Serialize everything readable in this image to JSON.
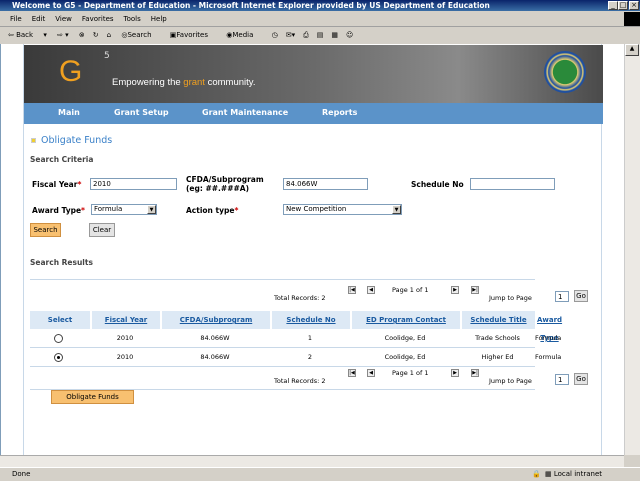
{
  "window": {
    "title": "Welcome to G5 - Department of Education - Microsoft Internet Explorer provided by US Department of Education"
  },
  "menu": [
    "File",
    "Edit",
    "View",
    "Favorites",
    "Tools",
    "Help"
  ],
  "toolbar": {
    "back": "Back",
    "search": "Search",
    "favorites": "Favorites",
    "media": "Media"
  },
  "banner": {
    "logo": "G",
    "logo_sup": "5",
    "tagline_pre": "Empowering the ",
    "tagline_accent": "grant",
    "tagline_post": " community."
  },
  "nav": [
    "Main",
    "Grant Setup",
    "Grant Maintenance",
    "Reports"
  ],
  "page": {
    "title": "Obligate Funds",
    "criteria_heading": "Search Criteria",
    "results_heading": "Search Results"
  },
  "form": {
    "fiscal_year_label": "Fiscal Year",
    "fiscal_year_value": "2010",
    "cfda_label": "CFDA/Subprogram",
    "cfda_hint": "(eg: ##.###A)",
    "cfda_value": "84.066W",
    "schedule_label": "Schedule No",
    "schedule_value": "",
    "award_type_label": "Award Type",
    "award_type_value": "Formula",
    "action_type_label": "Action type",
    "action_type_value": "New Competition",
    "required_mark": "*",
    "search_button": "Search",
    "clear_button": "Clear"
  },
  "pager": {
    "total": "Total Records: 2",
    "page": "Page 1 of 1",
    "jump_label": "Jump to Page",
    "jump_value": "1",
    "go": "Go"
  },
  "table": {
    "columns": [
      "Select",
      "Fiscal Year",
      "CFDA/Subprogram",
      "Schedule No",
      "ED Program Contact",
      "Schedule Title",
      "Award Type"
    ],
    "rows": [
      {
        "selected": false,
        "cells": [
          "2010",
          "84.066W",
          "1",
          "Coolidge, Ed",
          "Trade Schools",
          "Formula"
        ]
      },
      {
        "selected": true,
        "cells": [
          "2010",
          "84.066W",
          "2",
          "Coolidge, Ed",
          "Higher Ed",
          "Formula"
        ]
      }
    ]
  },
  "obligate_button": "Obligate Funds",
  "status": {
    "text": "Done",
    "zone": "Local intranet"
  },
  "colors": {
    "nav": "#5b93c9",
    "accent": "#f0a020",
    "primary_button": "#f8c070",
    "link": "#1a5aa0"
  }
}
